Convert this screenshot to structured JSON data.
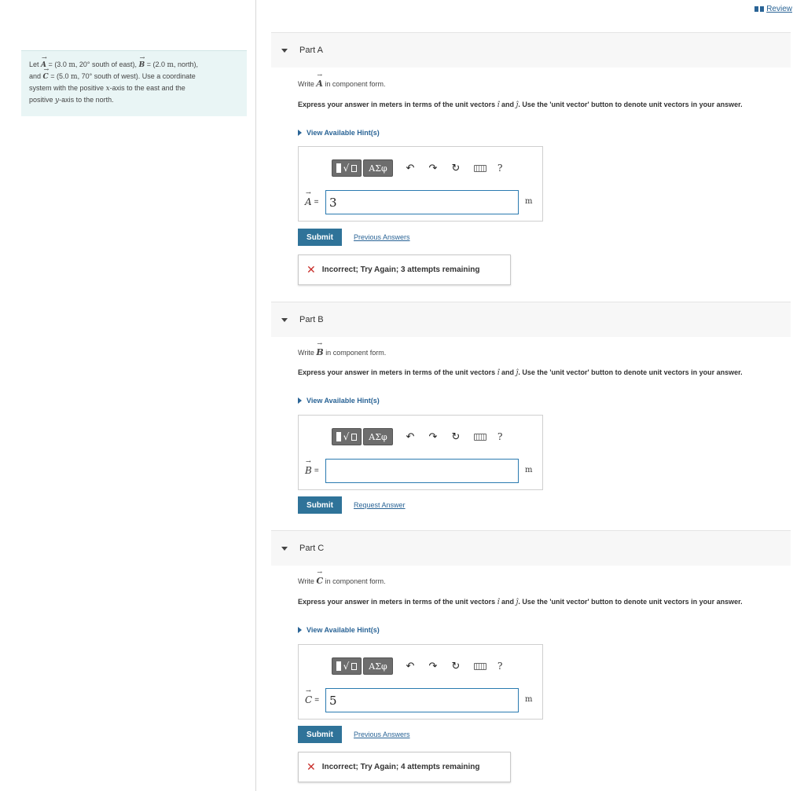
{
  "header": {
    "review_label": "Review"
  },
  "problem": {
    "let": "Let",
    "a_sym": "A",
    "eq": "=",
    "a_val": "(3.0",
    "unit_m": "m",
    "a_dir": ", 20° south of east),",
    "b_sym": "B",
    "b_val": "(2.0",
    "b_dir": ", north),",
    "and": "and",
    "c_sym": "C",
    "c_val": "(5.0",
    "c_dir": ", 70° south of west). Use a coordinate",
    "line3": "system with the positive",
    "x_sym": "x",
    "line3b": "-axis to the east and the",
    "line4": "positive",
    "y_sym": "y",
    "line4b": "-axis to the north."
  },
  "common": {
    "write": "Write",
    "in_component": "in component form.",
    "express_pre": "Express your answer in meters in terms of the unit vectors",
    "i_hat": "î",
    "and": "and",
    "j_hat": "ĵ",
    "express_post": ". Use the 'unit vector' button to denote unit vectors in your answer.",
    "hint_label": "View Available Hint(s)",
    "greek": "ΑΣφ",
    "radical": "√",
    "undo": "↶",
    "redo": "↷",
    "reset": "↻",
    "help": "?",
    "unit": "m",
    "submit": "Submit",
    "equals": "="
  },
  "parts": [
    {
      "title": "Part A",
      "vector": "A",
      "input_value": "3",
      "link": "Previous Answers",
      "feedback": "Incorrect; Try Again; 3 attempts remaining"
    },
    {
      "title": "Part B",
      "vector": "B",
      "input_value": "",
      "link": "Request Answer"
    },
    {
      "title": "Part C",
      "vector": "C",
      "input_value": "5",
      "link": "Previous Answers",
      "feedback": "Incorrect; Try Again; 4 attempts remaining"
    }
  ],
  "icons": {
    "review": "book-icon",
    "collapse": "triangle-down-icon",
    "hint": "caret-right-icon",
    "incorrect": "x-mark-icon"
  },
  "colors": {
    "accent": "#2f7399",
    "link": "#2a6496",
    "error": "#c9302c",
    "problem_bg": "#e9f5f5"
  }
}
